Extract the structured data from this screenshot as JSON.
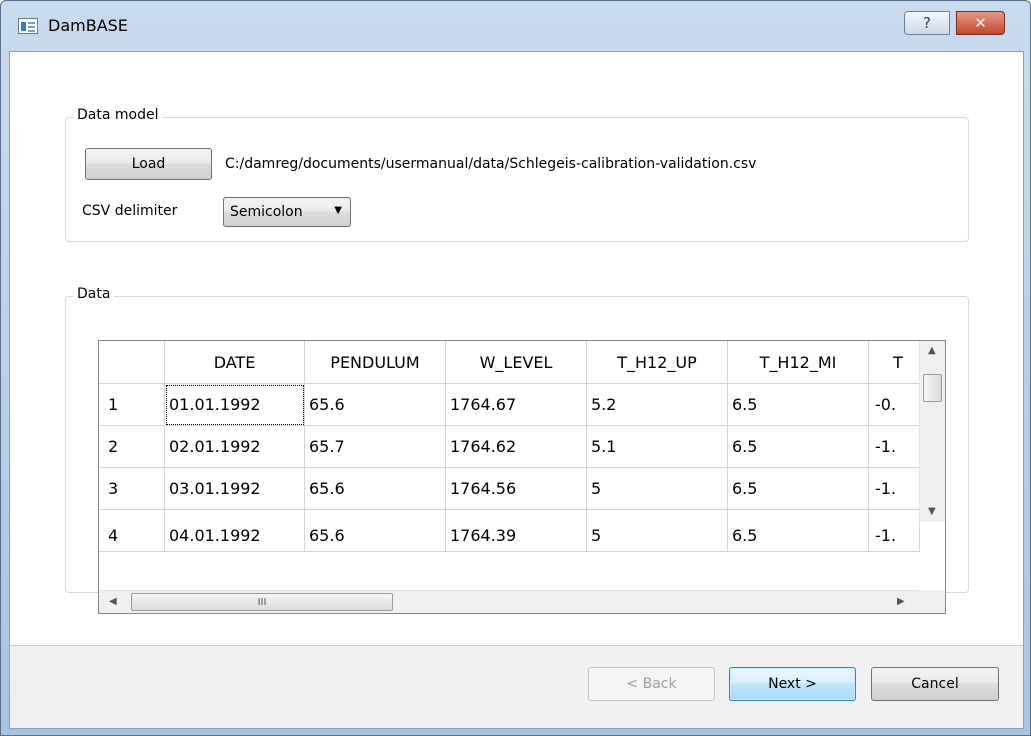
{
  "window": {
    "title": "DamBASE",
    "help_label": "?",
    "close_label": "✕"
  },
  "data_model": {
    "group_title": "Data model",
    "load_label": "Load",
    "file_path": "C:/damreg/documents/usermanual/data/Schlegeis-calibration-validation.csv",
    "delimiter_label": "CSV delimiter",
    "delimiter_value": "Semicolon"
  },
  "data_group": {
    "group_title": "Data",
    "columns": [
      "DATE",
      "PENDULUM",
      "W_LEVEL",
      "T_H12_UP",
      "T_H12_MI",
      "T"
    ],
    "rows": [
      {
        "num": "1",
        "cells": [
          "01.01.1992",
          "65.6",
          "1764.67",
          "5.2",
          "6.5",
          "-0."
        ]
      },
      {
        "num": "2",
        "cells": [
          "02.01.1992",
          "65.7",
          "1764.62",
          "5.1",
          "6.5",
          "-1."
        ]
      },
      {
        "num": "3",
        "cells": [
          "03.01.1992",
          "65.6",
          "1764.56",
          "5",
          "6.5",
          "-1."
        ]
      },
      {
        "num": "4",
        "cells": [
          "04.01.1992",
          "65.6",
          "1764.39",
          "5",
          "6.5",
          "-1."
        ]
      }
    ],
    "hscroll_grip": "III"
  },
  "footer": {
    "back_label": "< Back",
    "next_label": "Next >",
    "cancel_label": "Cancel"
  }
}
